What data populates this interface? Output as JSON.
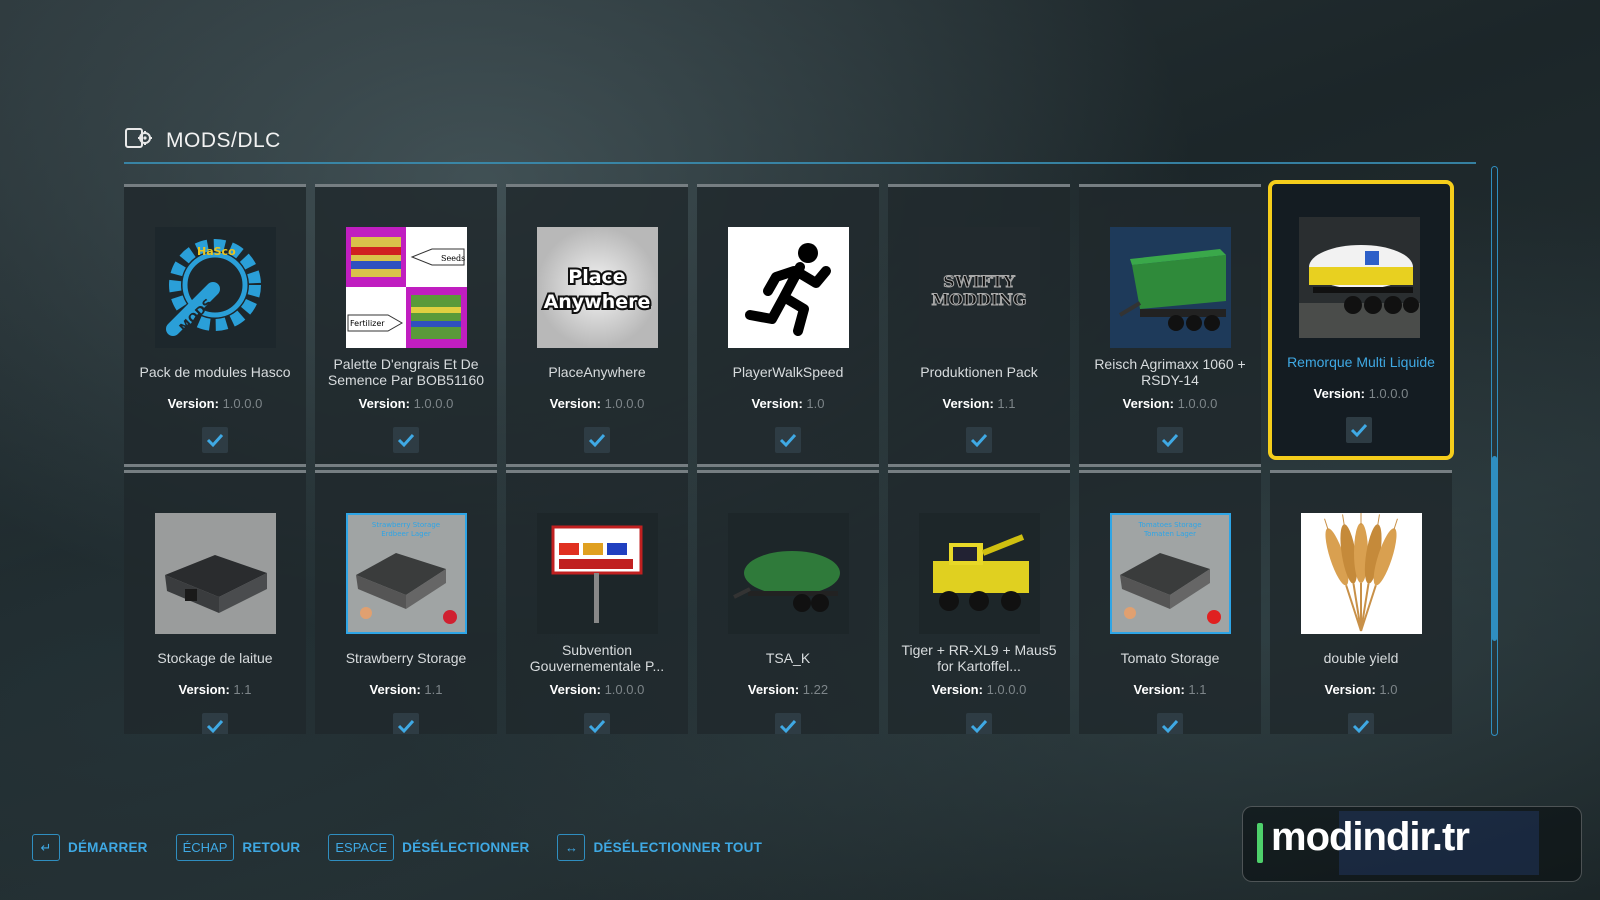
{
  "header": {
    "title": "MODS/DLC",
    "icon": "mods-icon"
  },
  "version_label": "Version:",
  "mods": [
    {
      "name": "Pack de modules Hasco",
      "version": "1.0.0.0",
      "enabled": true,
      "thumb": "hasco-gear-logo"
    },
    {
      "name": "Palette D'engrais Et De Semence Par BOB51160",
      "version": "1.0.0.0",
      "enabled": true,
      "thumb": "pallets",
      "thumb_labels": [
        "Seeds",
        "Fertilizer"
      ]
    },
    {
      "name": "PlaceAnywhere",
      "version": "1.0.0.0",
      "enabled": true,
      "thumb": "text-logo",
      "thumb_text": "Place Anywhere"
    },
    {
      "name": "PlayerWalkSpeed",
      "version": "1.0",
      "enabled": true,
      "thumb": "running-man"
    },
    {
      "name": "Produktionen Pack",
      "version": "1.1",
      "enabled": true,
      "thumb": "text-logo",
      "thumb_text": "SWIFTY MODDING"
    },
    {
      "name": "Reisch Agrimaxx 1060 + RSDY-14",
      "version": "1.0.0.0",
      "enabled": true,
      "thumb": "green-trailer"
    },
    {
      "name": "Remorque Multi Liquide",
      "version": "1.0.0.0",
      "enabled": true,
      "selected": true,
      "thumb": "tank-trailer"
    },
    {
      "name": "Stockage de laitue",
      "version": "1.1",
      "enabled": true,
      "thumb": "shed"
    },
    {
      "name": "Strawberry Storage",
      "version": "1.1",
      "enabled": true,
      "thumb": "storage-shed",
      "thumb_text": "Strawberry Storage Erdbeer Lager"
    },
    {
      "name": "Subvention Gouvernementale P...",
      "version": "1.0.0.0",
      "enabled": true,
      "thumb": "sign"
    },
    {
      "name": "TSA_K",
      "version": "1.22",
      "enabled": true,
      "thumb": "green-tanker"
    },
    {
      "name": "Tiger + RR-XL9 + Maus5 for Kartoffel...",
      "version": "1.0.0.0",
      "enabled": true,
      "thumb": "yellow-harvester"
    },
    {
      "name": "Tomato Storage",
      "version": "1.1",
      "enabled": true,
      "thumb": "storage-shed",
      "thumb_text": "Tomatoes Storage Tomaten Lager"
    },
    {
      "name": "double yield",
      "version": "1.0",
      "enabled": true,
      "thumb": "wheat"
    }
  ],
  "footer": [
    {
      "key": "↵",
      "label": "DÉMARRER",
      "icon": "enter-key-icon"
    },
    {
      "key": "ÉCHAP",
      "label": "RETOUR"
    },
    {
      "key": "ESPACE",
      "label": "DÉSÉLECTIONNER"
    },
    {
      "key": "↔",
      "label": "DÉSÉLECTIONNER TOUT",
      "icon": "left-right-key-icon"
    }
  ],
  "watermark": "modindir.tr",
  "colors": {
    "accent": "#3fa9e4",
    "selected_border": "#f5cd1b",
    "card_bg": "#20282c",
    "check": "#3fa9e4"
  }
}
